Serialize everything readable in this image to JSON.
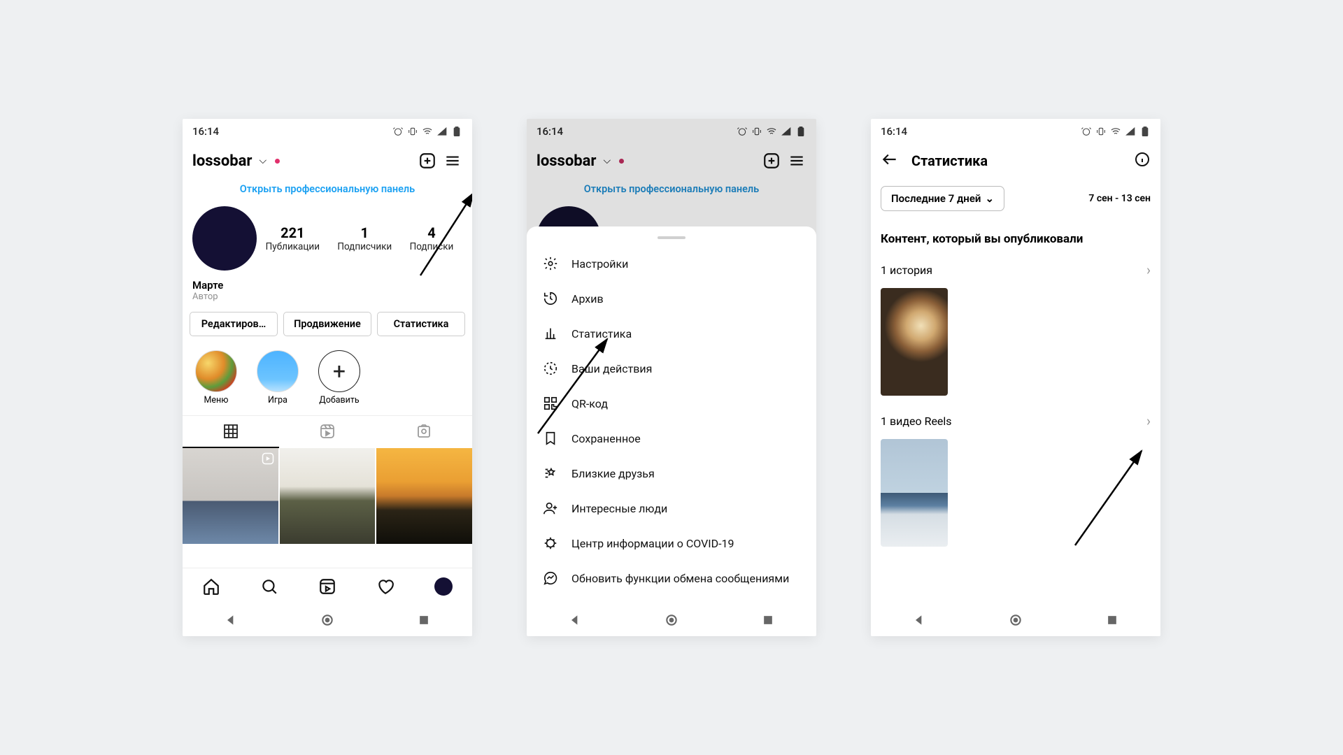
{
  "status": {
    "time": "16:14"
  },
  "profile": {
    "username": "lossobar",
    "pro_link": "Открыть профессиональную панель",
    "stats": {
      "posts": {
        "num": "221",
        "lbl": "Публикации"
      },
      "followers": {
        "num": "1",
        "lbl": "Подписчики"
      },
      "following": {
        "num": "4",
        "lbl": "Подписки"
      }
    },
    "display_name": "Марте",
    "role": "Автор",
    "buttons": {
      "edit": "Редактиров…",
      "promote": "Продвижение",
      "insights": "Статистика"
    },
    "highlights": {
      "menu": "Меню",
      "game": "Игра",
      "add": "Добавить"
    }
  },
  "menu": {
    "settings": "Настройки",
    "archive": "Архив",
    "insights": "Статистика",
    "activity": "Ваши действия",
    "qr": "QR-код",
    "saved": "Сохраненное",
    "close_friends": "Близкие друзья",
    "discover": "Интересные люди",
    "covid": "Центр информации о COVID-19",
    "messaging": "Обновить функции обмена сообщениями"
  },
  "insights": {
    "title": "Статистика",
    "period_btn": "Последние 7 дней",
    "period_range": "7 сен - 13 сен",
    "section_title": "Контент, который вы опубликовали",
    "story_row": "1 история",
    "reels_row": "1 видео Reels"
  }
}
